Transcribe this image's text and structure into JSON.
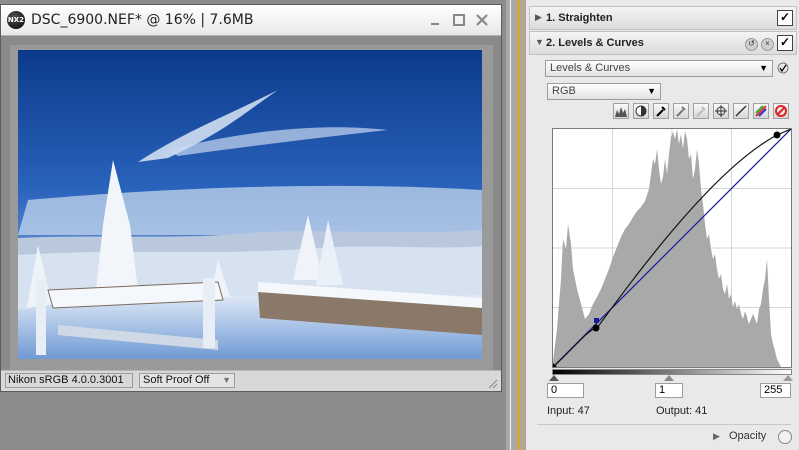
{
  "image_window": {
    "app_logo": "NX2",
    "title": "DSC_6900.NEF* @ 16% | 7.6MB",
    "minimize_icon": "minimize-icon",
    "maximize_icon": "maximize-icon",
    "close_icon": "close-icon",
    "color_profile": "Nikon sRGB 4.0.0.3001",
    "soft_proof": "Soft Proof Off"
  },
  "edit_list": {
    "step1": {
      "label": "1. Straighten",
      "checked": "✓"
    },
    "step2": {
      "label": "2. Levels & Curves",
      "checked": "✓",
      "reset_icon": "reset-icon",
      "delete_icon": "delete-icon",
      "mode_dropdown": "Levels & Curves",
      "channel_dropdown": "RGB",
      "tools": [
        "histogram-icon",
        "contrast-icon",
        "black-point-eyedropper-icon",
        "gray-point-eyedropper-icon",
        "white-point-eyedropper-icon",
        "anchor-point-icon",
        "linear-curve-icon",
        "auto-contrast-icon",
        "reset-curve-icon"
      ],
      "black_level": "0",
      "midtone": "1",
      "white_level": "255",
      "input_readout": "Input: 47",
      "output_readout": "Output: 41",
      "opacity_label": "Opacity"
    }
  },
  "colors": {
    "panel_bg": "#e9e9e9",
    "histogram": "#a9a9a9",
    "curve": "#000000",
    "rgb_line": "#1a1a99",
    "divider_accent": "#d2a83a"
  }
}
